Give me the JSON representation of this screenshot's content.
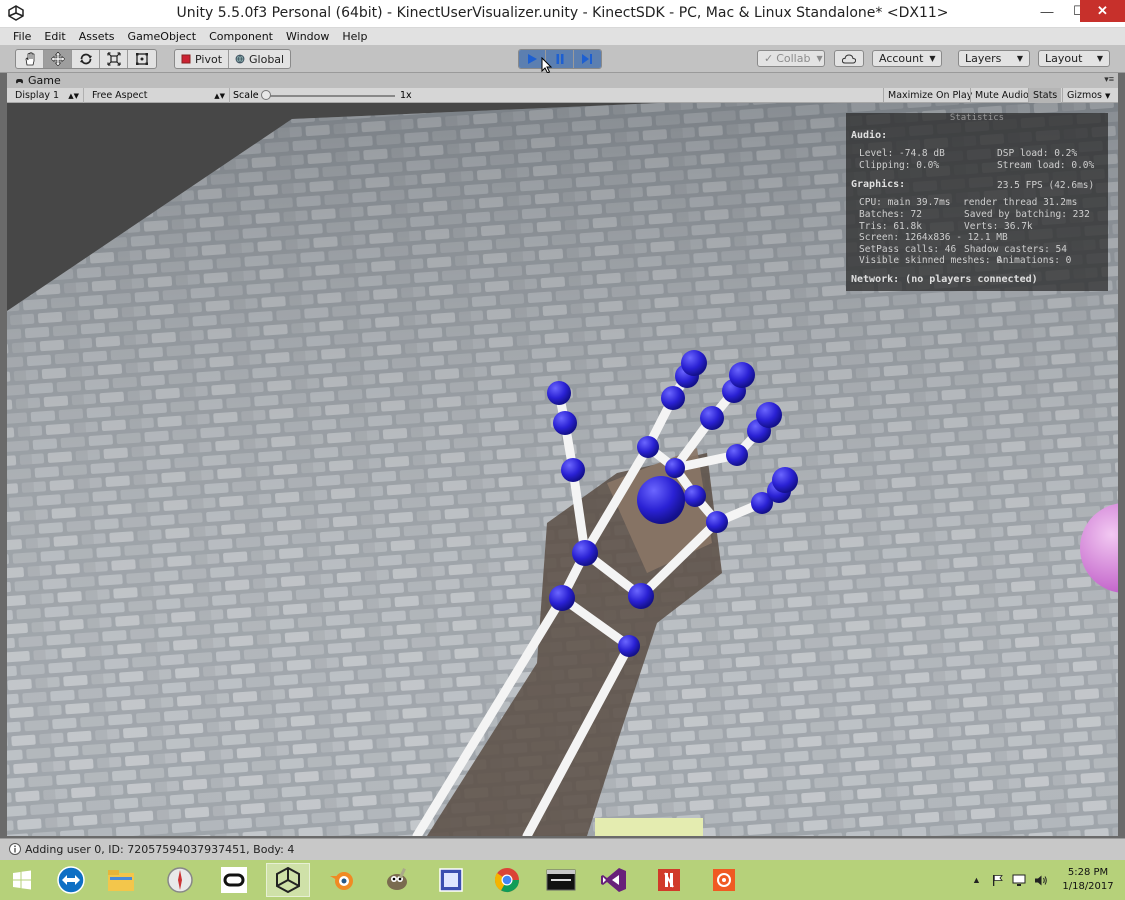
{
  "window": {
    "title": "Unity 5.5.0f3 Personal (64bit) - KinectUserVisualizer.unity - KinectSDK - PC, Mac & Linux Standalone* <DX11>",
    "minimize": "—",
    "maximize": "☐",
    "close": "✕"
  },
  "menu": [
    "File",
    "Edit",
    "Assets",
    "GameObject",
    "Component",
    "Window",
    "Help"
  ],
  "toolbar": {
    "pivot_label": "Pivot",
    "global_label": "Global",
    "collab_label": "Collab",
    "account_label": "Account",
    "layers_label": "Layers",
    "layout_label": "Layout"
  },
  "game_view": {
    "tab_label": "Game",
    "display_label": "Display 1",
    "aspect_label": "Free Aspect",
    "scale_label": "Scale",
    "scale_value": "1x",
    "scale_fraction": 0.0,
    "maximize_on_play": "Maximize On Play",
    "mute_audio": "Mute Audio",
    "stats_label": "Stats",
    "gizmos_label": "Gizmos"
  },
  "stats": {
    "header": "Statistics",
    "audio_title": "Audio:",
    "level": "Level: -74.8 dB",
    "clipping": "Clipping: 0.0%",
    "dsp_load": "DSP load: 0.2%",
    "stream_load": "Stream load: 0.0%",
    "graphics_title": "Graphics:",
    "fps": "23.5 FPS (42.6ms)",
    "cpu_main": "CPU: main 39.7ms",
    "render_thread": "render thread 31.2ms",
    "batches": "Batches: 72",
    "saved_batching": "Saved by batching: 232",
    "tris": "Tris: 61.8k",
    "verts": "Verts: 36.7k",
    "screen": "Screen: 1264x836 - 12.1 MB",
    "setpass": "SetPass calls: 46",
    "shadow_casters": "Shadow casters: 54",
    "skinned": "Visible skinned meshes: 0",
    "animations": "Animations: 0",
    "network": "Network: (no players connected)"
  },
  "status": {
    "message": "Adding user 0, ID: 72057594037937451, Body: 4"
  },
  "taskbar": {
    "time": "5:28 PM",
    "date": "1/18/2017"
  },
  "colors": {
    "toolbar_bg": "#c2c2c2",
    "play_active": "#5c7fb0",
    "joint_blue": "#2a21d4",
    "taskbar_bg": "#b6d17a",
    "close_red": "#c7302b"
  }
}
